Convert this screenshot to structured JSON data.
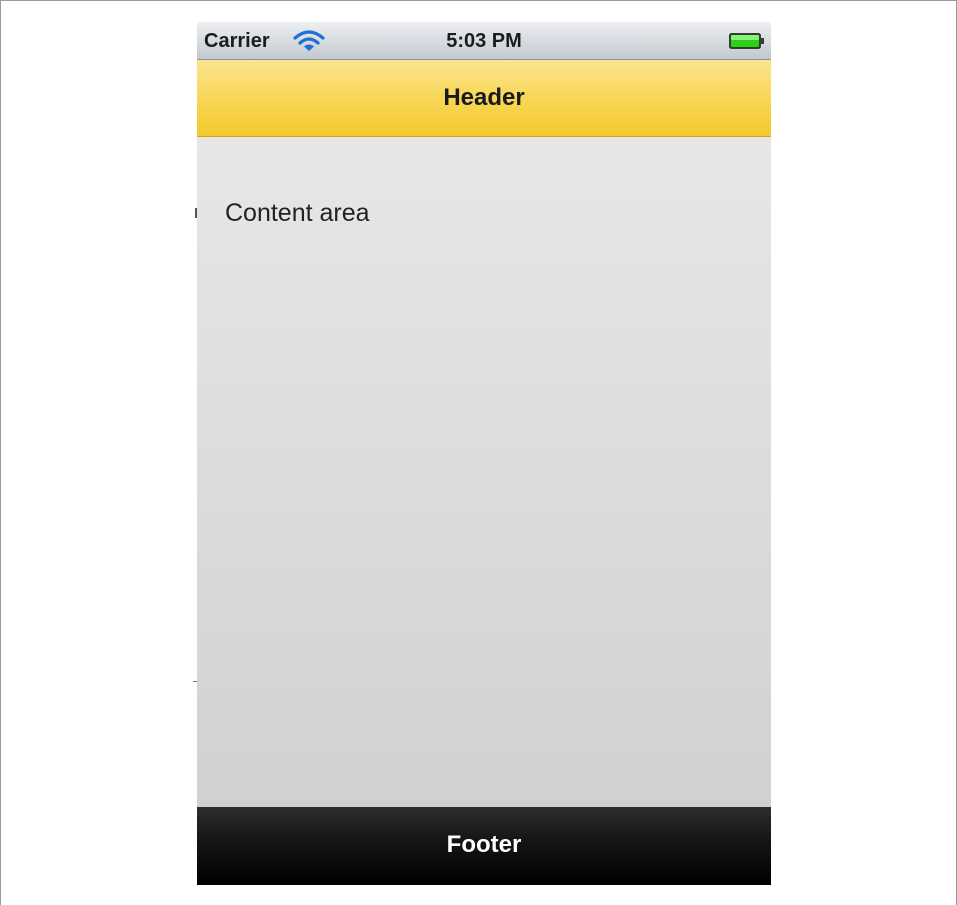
{
  "status_bar": {
    "carrier": "Carrier",
    "time": "5:03 PM",
    "wifi_icon": "wifi-icon",
    "battery_icon": "battery-full-icon",
    "battery_color": "#2bd11c"
  },
  "header": {
    "title": "Header",
    "color": "#f8d757"
  },
  "content": {
    "text": "Content area"
  },
  "footer": {
    "title": "Footer",
    "color": "#000000"
  }
}
